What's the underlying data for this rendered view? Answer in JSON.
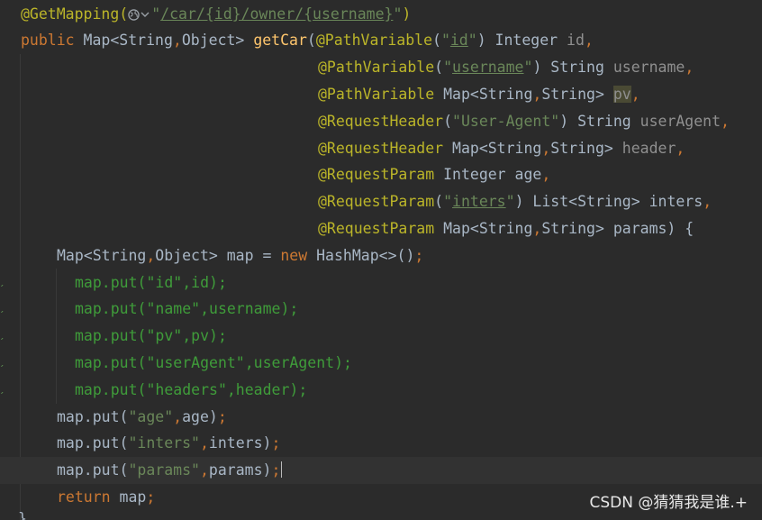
{
  "editor": {
    "lines": [
      {
        "tokens": [
          {
            "text": "@GetMapping(",
            "kind": "ann"
          },
          {
            "icon": "globe-icon"
          },
          {
            "icon": "chevron-down-icon"
          },
          {
            "text": "\"",
            "kind": "str"
          },
          {
            "text": "/car/{id}/owner/{username}",
            "kind": "str-u"
          },
          {
            "text": "\"",
            "kind": "str"
          },
          {
            "text": ")",
            "kind": "ann"
          }
        ]
      },
      {
        "tokens": [
          {
            "text": "public ",
            "kind": "kw"
          },
          {
            "text": "Map<String",
            "kind": "plain"
          },
          {
            "text": ",",
            "kind": "comma"
          },
          {
            "text": "Object> ",
            "kind": "plain"
          },
          {
            "text": "getCar",
            "kind": "fn"
          },
          {
            "text": "(",
            "kind": "plain"
          },
          {
            "text": "@PathVariable",
            "kind": "ann"
          },
          {
            "text": "(",
            "kind": "plain"
          },
          {
            "text": "\"",
            "kind": "str"
          },
          {
            "text": "id",
            "kind": "str-u"
          },
          {
            "text": "\"",
            "kind": "str"
          },
          {
            "text": ") Integer ",
            "kind": "plain"
          },
          {
            "text": "id",
            "kind": "param-dim"
          },
          {
            "text": ",",
            "kind": "comma"
          }
        ]
      },
      {
        "tokens": [
          {
            "text": "@PathVariable",
            "kind": "ann"
          },
          {
            "text": "(",
            "kind": "plain"
          },
          {
            "text": "\"",
            "kind": "str"
          },
          {
            "text": "username",
            "kind": "str-u"
          },
          {
            "text": "\"",
            "kind": "str"
          },
          {
            "text": ") String ",
            "kind": "plain"
          },
          {
            "text": "username",
            "kind": "param-dim"
          },
          {
            "text": ",",
            "kind": "comma"
          }
        ]
      },
      {
        "tokens": [
          {
            "text": "@PathVariable ",
            "kind": "ann"
          },
          {
            "text": "Map<String",
            "kind": "plain"
          },
          {
            "text": ",",
            "kind": "comma"
          },
          {
            "text": "String> ",
            "kind": "plain"
          },
          {
            "text": "pv",
            "kind": "param-dim",
            "highlight": true
          },
          {
            "text": ",",
            "kind": "comma"
          }
        ]
      },
      {
        "tokens": [
          {
            "text": "@RequestHeader",
            "kind": "ann"
          },
          {
            "text": "(",
            "kind": "plain"
          },
          {
            "text": "\"User-Agent\"",
            "kind": "str"
          },
          {
            "text": ") String ",
            "kind": "plain"
          },
          {
            "text": "userAgent",
            "kind": "param-dim"
          },
          {
            "text": ",",
            "kind": "comma"
          }
        ]
      },
      {
        "tokens": [
          {
            "text": "@RequestHeader ",
            "kind": "ann"
          },
          {
            "text": "Map<String",
            "kind": "plain"
          },
          {
            "text": ",",
            "kind": "comma"
          },
          {
            "text": "String> ",
            "kind": "plain"
          },
          {
            "text": "header",
            "kind": "param-dim"
          },
          {
            "text": ",",
            "kind": "comma"
          }
        ]
      },
      {
        "tokens": [
          {
            "text": "@RequestParam ",
            "kind": "ann"
          },
          {
            "text": "Integer age",
            "kind": "plain"
          },
          {
            "text": ",",
            "kind": "comma"
          }
        ]
      },
      {
        "tokens": [
          {
            "text": "@RequestParam",
            "kind": "ann"
          },
          {
            "text": "(",
            "kind": "plain"
          },
          {
            "text": "\"",
            "kind": "str"
          },
          {
            "text": "inters",
            "kind": "str-u"
          },
          {
            "text": "\"",
            "kind": "str"
          },
          {
            "text": ") List<String> inters",
            "kind": "plain"
          },
          {
            "text": ",",
            "kind": "comma"
          }
        ]
      },
      {
        "tokens": [
          {
            "text": "@RequestParam ",
            "kind": "ann"
          },
          {
            "text": "Map<String",
            "kind": "plain"
          },
          {
            "text": ",",
            "kind": "comma"
          },
          {
            "text": "String> params) {",
            "kind": "plain"
          }
        ]
      },
      {
        "tokens": [
          {
            "text": "Map<String",
            "kind": "plain"
          },
          {
            "text": ",",
            "kind": "comma"
          },
          {
            "text": "Object> map = ",
            "kind": "plain"
          },
          {
            "text": "new ",
            "kind": "kw"
          },
          {
            "text": "HashMap<>()",
            "kind": "plain"
          },
          {
            "text": ";",
            "kind": "comma"
          }
        ]
      },
      {
        "tokens": [
          {
            "text": "map.put(\"id\",id);",
            "kind": "green"
          }
        ]
      },
      {
        "tokens": [
          {
            "text": "map.put(\"name\",username);",
            "kind": "green"
          }
        ]
      },
      {
        "tokens": [
          {
            "text": "map.put(\"pv\",pv);",
            "kind": "green"
          }
        ]
      },
      {
        "tokens": [
          {
            "text": "map.put(\"userAgent\",userAgent);",
            "kind": "green"
          }
        ]
      },
      {
        "tokens": [
          {
            "text": "map.put(\"headers\",header);",
            "kind": "green"
          }
        ]
      },
      {
        "tokens": [
          {
            "text": "map.put(",
            "kind": "plain"
          },
          {
            "text": "\"age\"",
            "kind": "str"
          },
          {
            "text": ",",
            "kind": "comma"
          },
          {
            "text": "age)",
            "kind": "plain"
          },
          {
            "text": ";",
            "kind": "comma"
          }
        ]
      },
      {
        "tokens": [
          {
            "text": "map.put(",
            "kind": "plain"
          },
          {
            "text": "\"inters\"",
            "kind": "str"
          },
          {
            "text": ",",
            "kind": "comma"
          },
          {
            "text": "inters)",
            "kind": "plain"
          },
          {
            "text": ";",
            "kind": "comma"
          }
        ]
      },
      {
        "tokens": [
          {
            "text": "map.put(",
            "kind": "plain"
          },
          {
            "text": "\"params\"",
            "kind": "str"
          },
          {
            "text": ",",
            "kind": "comma"
          },
          {
            "text": "params)",
            "kind": "plain"
          },
          {
            "text": ";",
            "kind": "comma"
          }
        ]
      },
      {
        "tokens": [
          {
            "text": "return ",
            "kind": "kw"
          },
          {
            "text": "map",
            "kind": "plain"
          },
          {
            "text": ";",
            "kind": "comma"
          }
        ]
      }
    ],
    "closing_brace": "}"
  },
  "watermark": "CSDN @猜猜我是谁.+",
  "colors": {
    "background": "#2b2b2b",
    "annotation": "#bbb529",
    "keyword": "#cc7832",
    "method": "#ffc66d",
    "string": "#6a8759",
    "text": "#a9b7c6",
    "dim_param": "#8f8f8f",
    "commented_green": "#3f9c3a"
  }
}
